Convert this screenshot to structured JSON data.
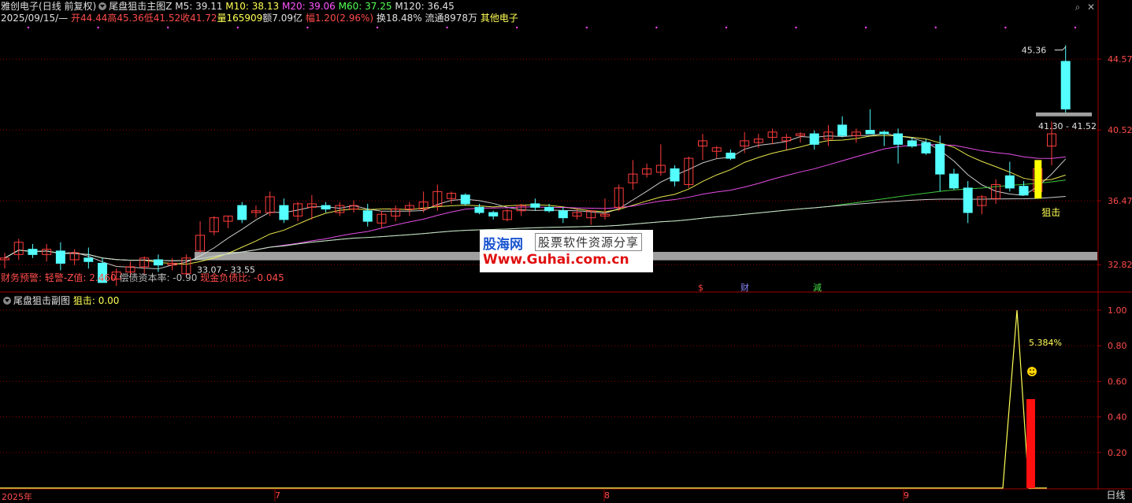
{
  "window": {
    "stock_name": "雅创电子",
    "period": "(日线 前复权)",
    "main_indicator": "尾盘狙击主图Z",
    "sub_indicator": "尾盘狙击副图"
  },
  "ma_legend": [
    {
      "label": "M5: 39.11",
      "color": "#e0e0e0"
    },
    {
      "label": "M10: 38.13",
      "color": "#ffff55"
    },
    {
      "label": "M20: 39.06",
      "color": "#ff55ff"
    },
    {
      "label": "M60: 37.25",
      "color": "#55ff55"
    },
    {
      "label": "M120: 36.45",
      "color": "#e0e0e0"
    }
  ],
  "quote_line": {
    "date": "2025/09/15/—",
    "open": "开44.44",
    "high": "高45.36",
    "low": "低41.52",
    "close": "收41.72",
    "volume": "量165909",
    "amount": "额7.09亿",
    "change": "幅1.20(2.96%)",
    "turnover": "换18.48%",
    "float": "流通8978万",
    "sector": "其他电子"
  },
  "warning_line": {
    "prefix": "财务预警: 轻警-Z值: 2.460",
    "mid": "偿债资本率: -0.90",
    "suffix": "现金负债比: -0.045"
  },
  "sub_legend": {
    "label": "狙击: 0.00"
  },
  "annotations": {
    "peak_price": "45.36",
    "range_right": "41.30 - 41.52",
    "range_left": "33.07 - 33.55",
    "signal_label": "狙击",
    "sub_percent": "5.384%",
    "event_s": "$",
    "event_cai": "财",
    "event_jian": "減"
  },
  "logo": {
    "name": "股海网",
    "tagline": "股票软件资源分享",
    "url": "Www.Guhai.com.cn"
  },
  "bottom_bar": {
    "year_label": "2025年",
    "months": [
      "7",
      "8",
      "9"
    ],
    "period_tab": "日线"
  },
  "colors": {
    "up": "#ff3c3c",
    "down": "#54ffff",
    "grid": "#8b0000",
    "axis": "#a00000",
    "ma5": "#e0e0e0",
    "ma10": "#ffff55",
    "ma20": "#ff55ff",
    "ma60": "#44dd44",
    "ma120": "#e0e0e0",
    "band": "#a0a0a0",
    "signal_bar": "#ffff00",
    "sub_line": "#ffff55",
    "sub_bar": "#ff1010"
  },
  "chart_data": [
    {
      "type": "candlestick",
      "title": "尾盘狙击主图Z",
      "y_axis_ticks": [
        44.57,
        40.52,
        36.47,
        32.82
      ],
      "ylim": [
        31.3,
        46.6
      ],
      "grid": true,
      "candles": [
        {
          "o": 33.1,
          "h": 33.5,
          "l": 32.6,
          "c": 33.2
        },
        {
          "o": 33.4,
          "h": 34.3,
          "l": 33.1,
          "c": 34.1
        },
        {
          "o": 33.7,
          "h": 34.0,
          "l": 33.2,
          "c": 33.4
        },
        {
          "o": 33.4,
          "h": 34.0,
          "l": 33.0,
          "c": 33.7
        },
        {
          "o": 33.6,
          "h": 34.1,
          "l": 32.5,
          "c": 32.9
        },
        {
          "o": 33.1,
          "h": 33.7,
          "l": 32.8,
          "c": 33.5
        },
        {
          "o": 33.2,
          "h": 33.8,
          "l": 32.6,
          "c": 33.0
        },
        {
          "o": 32.9,
          "h": 33.2,
          "l": 32.0,
          "c": 31.8
        },
        {
          "o": 32.0,
          "h": 32.6,
          "l": 31.6,
          "c": 32.4
        },
        {
          "o": 32.4,
          "h": 33.0,
          "l": 32.1,
          "c": 32.7
        },
        {
          "o": 32.7,
          "h": 33.3,
          "l": 32.3,
          "c": 33.2
        },
        {
          "o": 33.1,
          "h": 33.4,
          "l": 32.4,
          "c": 32.8
        },
        {
          "o": 32.8,
          "h": 33.2,
          "l": 32.5,
          "c": 32.9
        },
        {
          "o": 32.3,
          "h": 33.4,
          "l": 32.1,
          "c": 33.2
        },
        {
          "o": 33.6,
          "h": 35.3,
          "l": 33.5,
          "c": 34.5
        },
        {
          "o": 34.7,
          "h": 35.6,
          "l": 34.5,
          "c": 35.5
        },
        {
          "o": 35.3,
          "h": 35.6,
          "l": 34.9,
          "c": 35.6
        },
        {
          "o": 36.2,
          "h": 36.4,
          "l": 35.2,
          "c": 35.4
        },
        {
          "o": 35.8,
          "h": 36.2,
          "l": 35.5,
          "c": 35.9
        },
        {
          "o": 35.8,
          "h": 37.0,
          "l": 35.6,
          "c": 36.7
        },
        {
          "o": 36.2,
          "h": 36.6,
          "l": 35.2,
          "c": 35.4
        },
        {
          "o": 35.6,
          "h": 36.4,
          "l": 35.3,
          "c": 36.3
        },
        {
          "o": 36.1,
          "h": 36.8,
          "l": 35.4,
          "c": 36.3
        },
        {
          "o": 36.2,
          "h": 36.4,
          "l": 35.8,
          "c": 36.0
        },
        {
          "o": 35.8,
          "h": 36.4,
          "l": 35.6,
          "c": 36.2
        },
        {
          "o": 36.0,
          "h": 36.5,
          "l": 35.8,
          "c": 36.2
        },
        {
          "o": 35.9,
          "h": 36.3,
          "l": 35.0,
          "c": 35.3
        },
        {
          "o": 35.2,
          "h": 35.9,
          "l": 34.9,
          "c": 35.7
        },
        {
          "o": 35.6,
          "h": 36.2,
          "l": 35.3,
          "c": 36.0
        },
        {
          "o": 36.0,
          "h": 36.4,
          "l": 35.6,
          "c": 36.2
        },
        {
          "o": 36.0,
          "h": 37.0,
          "l": 35.8,
          "c": 36.4
        },
        {
          "o": 36.2,
          "h": 37.4,
          "l": 35.9,
          "c": 37.0
        },
        {
          "o": 36.6,
          "h": 37.0,
          "l": 36.3,
          "c": 36.9
        },
        {
          "o": 36.8,
          "h": 36.9,
          "l": 36.2,
          "c": 36.3
        },
        {
          "o": 36.1,
          "h": 36.3,
          "l": 35.7,
          "c": 35.8
        },
        {
          "o": 35.8,
          "h": 35.9,
          "l": 35.4,
          "c": 35.6
        },
        {
          "o": 35.4,
          "h": 36.0,
          "l": 35.3,
          "c": 35.9
        },
        {
          "o": 35.9,
          "h": 36.3,
          "l": 35.6,
          "c": 36.2
        },
        {
          "o": 36.3,
          "h": 36.6,
          "l": 35.9,
          "c": 36.1
        },
        {
          "o": 36.1,
          "h": 36.3,
          "l": 35.8,
          "c": 35.9
        },
        {
          "o": 35.9,
          "h": 36.1,
          "l": 35.2,
          "c": 35.5
        },
        {
          "o": 35.6,
          "h": 36.0,
          "l": 35.4,
          "c": 35.8
        },
        {
          "o": 35.5,
          "h": 35.9,
          "l": 35.1,
          "c": 35.9
        },
        {
          "o": 35.6,
          "h": 36.6,
          "l": 35.4,
          "c": 35.7
        },
        {
          "o": 36.1,
          "h": 37.4,
          "l": 35.9,
          "c": 37.2
        },
        {
          "o": 37.5,
          "h": 38.8,
          "l": 37.1,
          "c": 38.0
        },
        {
          "o": 38.0,
          "h": 38.6,
          "l": 37.8,
          "c": 38.3
        },
        {
          "o": 38.1,
          "h": 39.7,
          "l": 37.9,
          "c": 38.5
        },
        {
          "o": 38.3,
          "h": 38.5,
          "l": 37.3,
          "c": 37.6
        },
        {
          "o": 37.4,
          "h": 39.0,
          "l": 37.2,
          "c": 38.9
        },
        {
          "o": 39.6,
          "h": 40.3,
          "l": 38.8,
          "c": 39.9
        },
        {
          "o": 39.3,
          "h": 39.6,
          "l": 38.9,
          "c": 39.5
        },
        {
          "o": 39.2,
          "h": 39.4,
          "l": 38.8,
          "c": 38.9
        },
        {
          "o": 39.6,
          "h": 40.4,
          "l": 39.2,
          "c": 39.9
        },
        {
          "o": 39.8,
          "h": 40.3,
          "l": 39.5,
          "c": 40.0
        },
        {
          "o": 40.1,
          "h": 40.6,
          "l": 39.7,
          "c": 40.4
        },
        {
          "o": 39.9,
          "h": 40.3,
          "l": 39.4,
          "c": 40.1
        },
        {
          "o": 40.2,
          "h": 40.4,
          "l": 39.8,
          "c": 40.3
        },
        {
          "o": 40.3,
          "h": 40.5,
          "l": 39.4,
          "c": 39.7
        },
        {
          "o": 40.0,
          "h": 40.8,
          "l": 39.6,
          "c": 40.4
        },
        {
          "o": 40.8,
          "h": 41.3,
          "l": 40.1,
          "c": 40.2
        },
        {
          "o": 40.2,
          "h": 40.6,
          "l": 39.8,
          "c": 40.4
        },
        {
          "o": 40.5,
          "h": 41.7,
          "l": 40.3,
          "c": 40.3
        },
        {
          "o": 40.4,
          "h": 40.5,
          "l": 39.6,
          "c": 40.3
        },
        {
          "o": 40.3,
          "h": 40.6,
          "l": 38.6,
          "c": 39.7
        },
        {
          "o": 39.9,
          "h": 40.1,
          "l": 39.5,
          "c": 39.6
        },
        {
          "o": 39.8,
          "h": 40.0,
          "l": 39.1,
          "c": 39.2
        },
        {
          "o": 39.7,
          "h": 40.2,
          "l": 37.0,
          "c": 38.0
        },
        {
          "o": 38.0,
          "h": 38.3,
          "l": 37.1,
          "c": 37.2
        },
        {
          "o": 37.2,
          "h": 37.6,
          "l": 35.2,
          "c": 35.8
        },
        {
          "o": 36.2,
          "h": 36.8,
          "l": 35.7,
          "c": 36.7
        },
        {
          "o": 36.6,
          "h": 37.7,
          "l": 36.3,
          "c": 37.4
        },
        {
          "o": 37.9,
          "h": 38.7,
          "l": 37.0,
          "c": 37.2
        },
        {
          "o": 37.3,
          "h": 37.6,
          "l": 36.8,
          "c": 36.8
        },
        {
          "o": 37.0,
          "h": 38.8,
          "l": 36.7,
          "c": 38.3
        },
        {
          "o": 39.6,
          "h": 41.0,
          "l": 38.5,
          "c": 40.3
        },
        {
          "o": 44.44,
          "h": 45.36,
          "l": 41.52,
          "c": 41.72
        }
      ],
      "signal_bar": {
        "index": 74,
        "top": 38.8,
        "bottom": 36.6
      }
    },
    {
      "type": "line",
      "title": "尾盘狙击副图",
      "series": [
        {
          "name": "狙击",
          "values": [
            0,
            1.0,
            0
          ]
        }
      ],
      "bar": {
        "value": 0.5
      },
      "y_axis_ticks": [
        1.0,
        0.8,
        0.6,
        0.4,
        0.2
      ],
      "ylim": [
        0,
        1.0
      ],
      "grid": true
    }
  ]
}
